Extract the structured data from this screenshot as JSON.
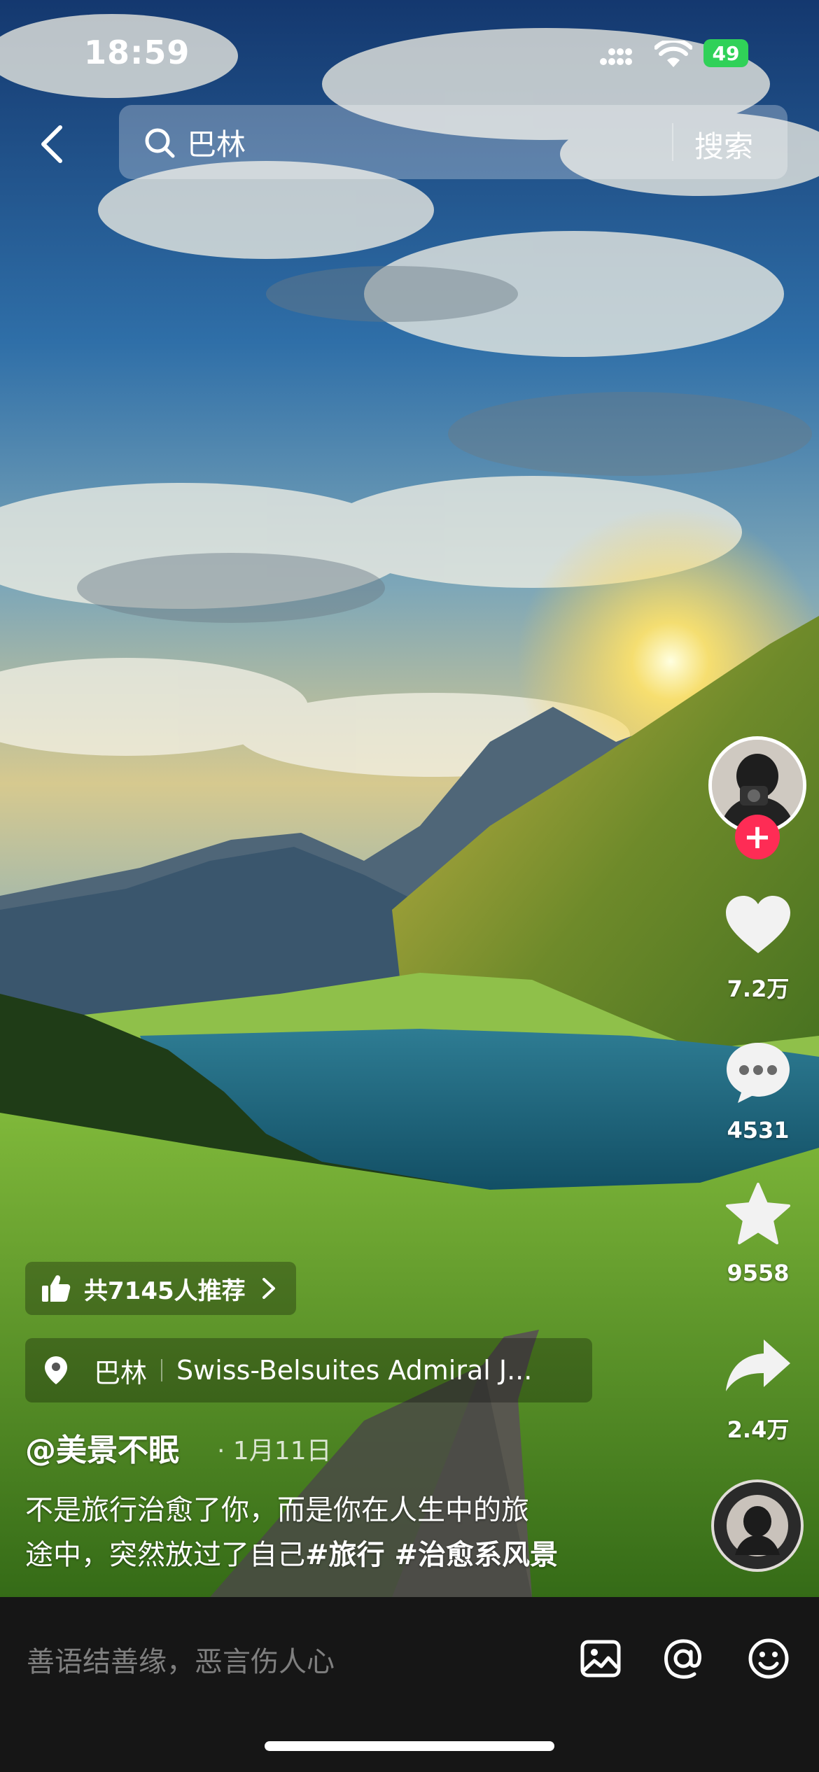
{
  "status_bar": {
    "time": "18:59",
    "battery": "49"
  },
  "search": {
    "query": "巴林",
    "button": "搜索"
  },
  "rail": {
    "likes": "7.2万",
    "comments": "4531",
    "favorites": "9558",
    "shares": "2.4万"
  },
  "recommend": {
    "label": "共7145人推荐"
  },
  "location": {
    "city": "巴林",
    "place": "Swiss-Belsuites Admiral J..."
  },
  "post": {
    "author": "@美景不眠",
    "date": "1月11日",
    "text_line1": "不是旅行治愈了你，而是你在人生中的旅",
    "text_line2_plain": "途中，突然放过了自己",
    "tags": "#旅行 #治愈系风景"
  },
  "comment_bar": {
    "placeholder": "善语结善缘，恶言伤人心"
  },
  "icons": [
    "back-icon",
    "search-icon",
    "heart-icon",
    "comment-icon",
    "star-icon",
    "share-icon",
    "thumbs-up-icon",
    "location-pin-icon",
    "image-icon",
    "at-icon",
    "emoji-icon"
  ]
}
